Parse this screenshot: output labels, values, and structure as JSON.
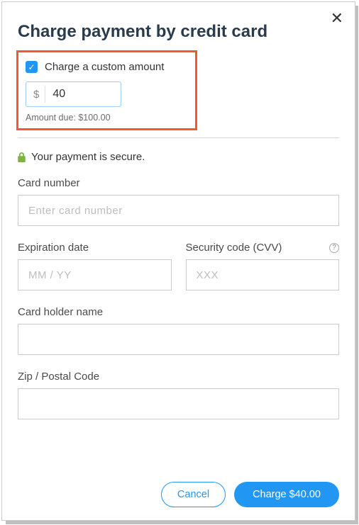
{
  "modal": {
    "title": "Charge payment by credit card",
    "close_symbol": "✕"
  },
  "custom_amount": {
    "checkbox_label": "Charge a custom amount",
    "currency_symbol": "$",
    "amount_value": "40",
    "amount_due_text": "Amount due: $100.00"
  },
  "secure": {
    "text": "Your payment is secure."
  },
  "fields": {
    "card_number": {
      "label": "Card number",
      "placeholder": "Enter card number"
    },
    "expiration": {
      "label": "Expiration date",
      "placeholder": "MM / YY"
    },
    "cvv": {
      "label": "Security code (CVV)",
      "placeholder": "XXX",
      "help_symbol": "?"
    },
    "card_holder": {
      "label": "Card holder name"
    },
    "zip": {
      "label": "Zip / Postal Code"
    }
  },
  "footer": {
    "cancel_label": "Cancel",
    "charge_label": "Charge $40.00"
  },
  "check_symbol": "✓"
}
